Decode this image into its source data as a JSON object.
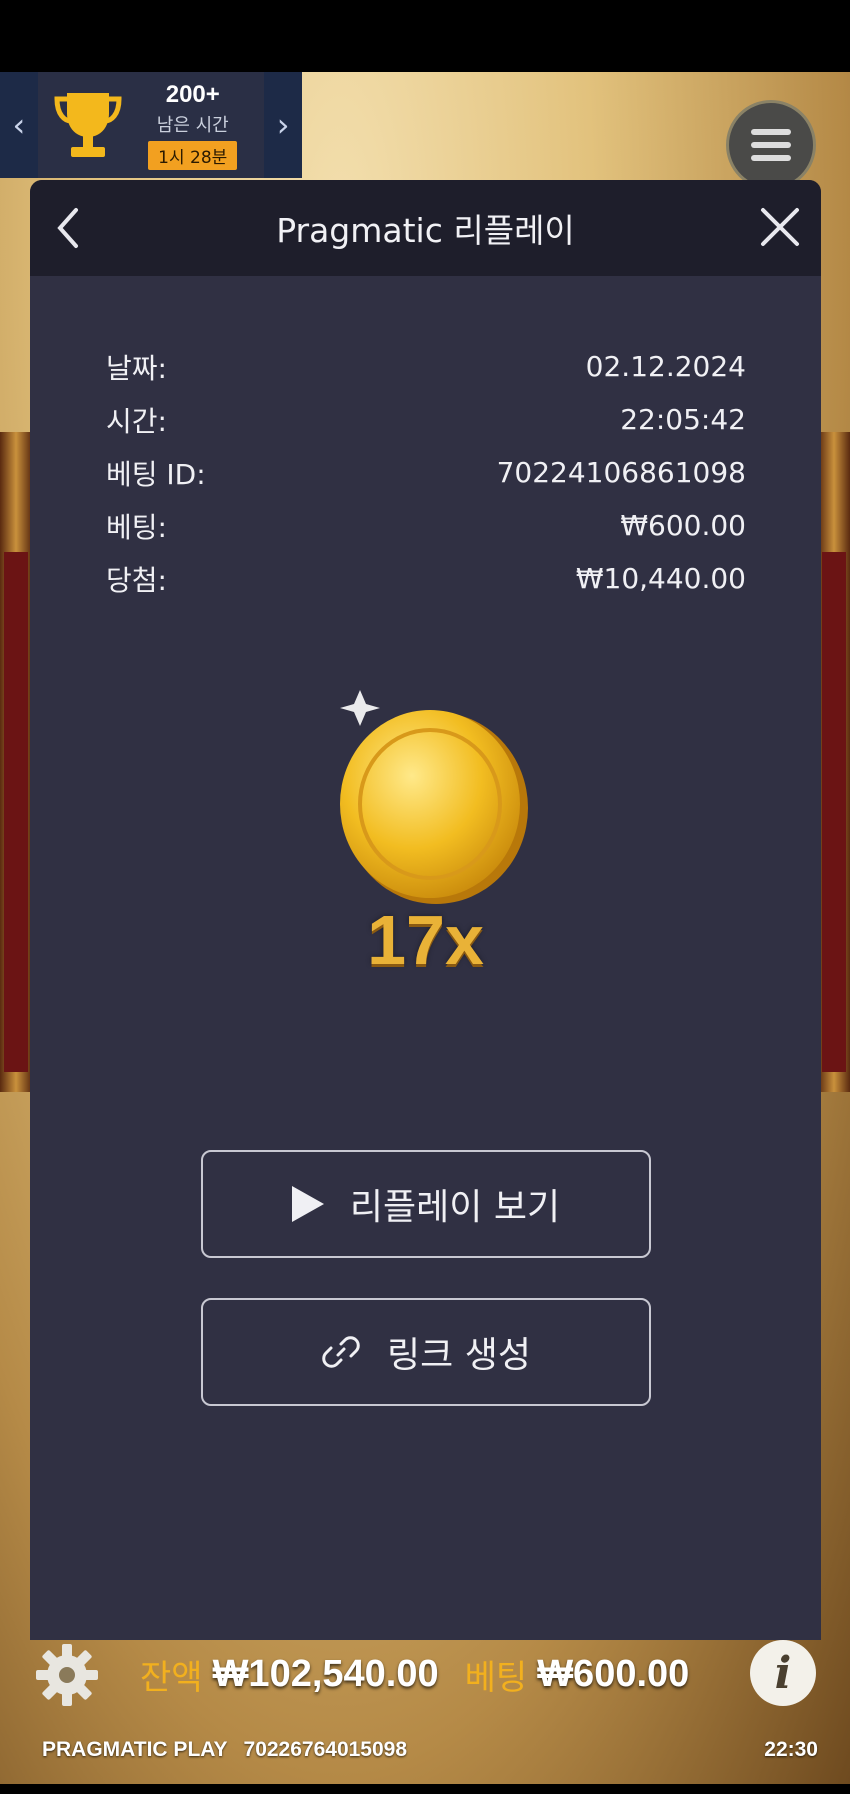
{
  "tournament": {
    "count": "200+",
    "remaining_label": "남은 시간",
    "timer": "1시 28분"
  },
  "modal": {
    "title": "Pragmatic 리플레이",
    "details": [
      {
        "label": "날짜:",
        "value": "02.12.2024"
      },
      {
        "label": "시간:",
        "value": "22:05:42"
      },
      {
        "label": "베팅 ID:",
        "value": "70224106861098"
      },
      {
        "label": "베팅:",
        "value": "₩600.00"
      },
      {
        "label": "당첨:",
        "value": "₩10,440.00"
      }
    ],
    "multiplier": "17x",
    "replay_button": "리플레이 보기",
    "link_button": "링크 생성"
  },
  "bottom": {
    "balance_label": "잔액",
    "balance_value": "₩102,540.00",
    "bet_label": "베팅",
    "bet_value": "₩600.00",
    "brand": "PRAGMATIC PLAY",
    "round_id": "70226764015098",
    "clock": "22:30"
  },
  "colors": {
    "modal_bg": "#303043",
    "header_bg": "#1e1e2b",
    "gold": "#e9b237",
    "label_orange": "#f2b01e"
  }
}
